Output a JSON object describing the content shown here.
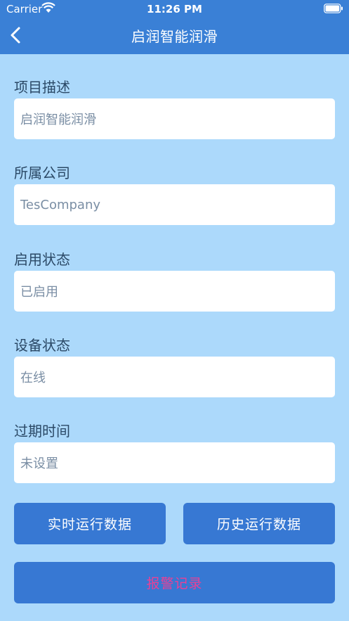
{
  "status_bar": {
    "carrier": "Carrier",
    "time": "11:26 PM"
  },
  "nav": {
    "title": "启润智能润滑"
  },
  "fields": [
    {
      "label": "项目描述",
      "value": "启润智能润滑"
    },
    {
      "label": "所属公司",
      "value": "TesCompany"
    },
    {
      "label": "启用状态",
      "value": "已启用"
    },
    {
      "label": "设备状态",
      "value": "在线"
    },
    {
      "label": "过期时间",
      "value": "未设置"
    }
  ],
  "buttons": {
    "realtime": "实时运行数据",
    "history": "历史运行数据",
    "alarm": "报警记录"
  },
  "colors": {
    "nav_bg": "#3a80d6",
    "page_bg": "#acd9fb",
    "button_bg": "#3778d3",
    "alarm_text": "#ec3f95"
  }
}
